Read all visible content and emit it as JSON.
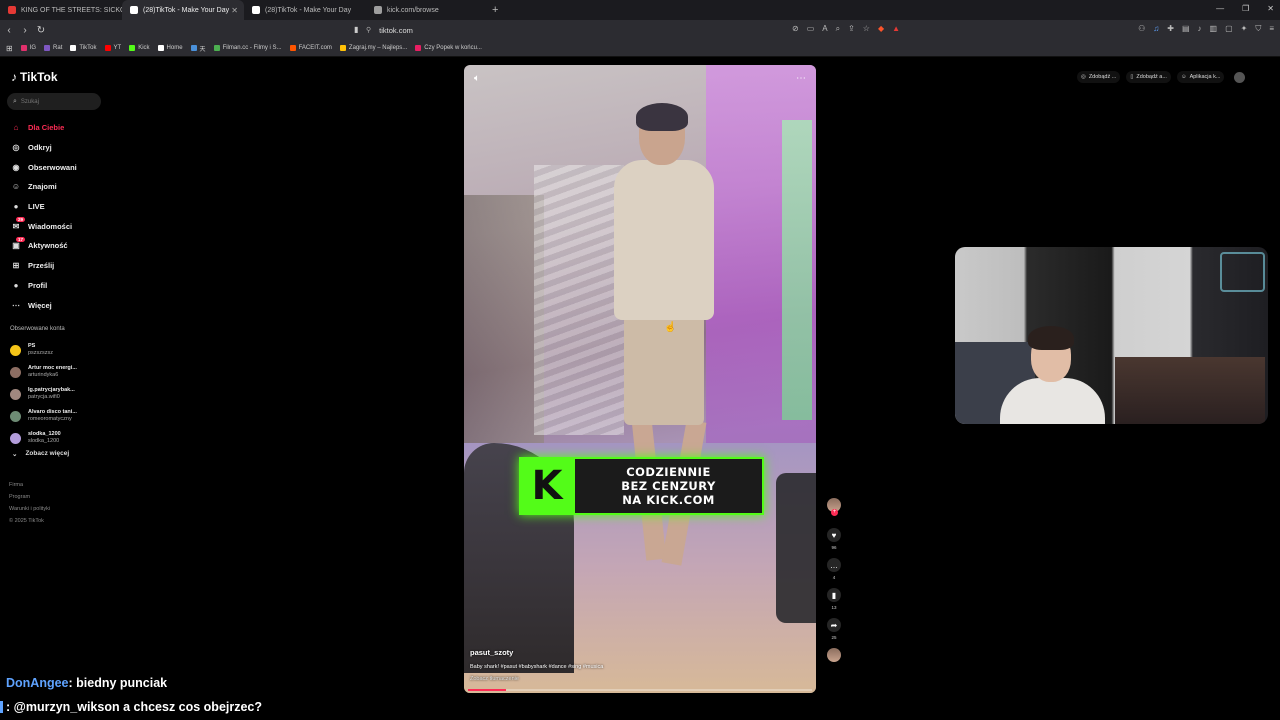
{
  "browser": {
    "tabs": [
      {
        "title": "KING OF THE STREETS: SICKO MODE",
        "color": "#e53935",
        "active": false
      },
      {
        "title": "(28)TikTok - Make Your Day",
        "color": "#ffffff",
        "active": true
      },
      {
        "title": "(28)TikTok - Make Your Day",
        "color": "#ffffff",
        "active": false
      },
      {
        "title": "kick.com/browse",
        "color": "#9e9e9e",
        "active": false
      }
    ],
    "address": "tiktok.com",
    "bookmarks": [
      {
        "label": "IG",
        "color": "#e1306c"
      },
      {
        "label": "Rat",
        "color": "#7e57c2"
      },
      {
        "label": "TikTok",
        "color": "#ffffff"
      },
      {
        "label": "YT",
        "color": "#ff0000"
      },
      {
        "label": "Kick",
        "color": "#53fc18"
      },
      {
        "label": "Home",
        "color": "#ffffff"
      },
      {
        "label": "天",
        "color": "#4a90d9"
      },
      {
        "label": "Filman.cc - Filmy i S...",
        "color": "#4caf50"
      },
      {
        "label": "FACEIT.com",
        "color": "#ff5500"
      },
      {
        "label": "Zagraj.my – Najleps...",
        "color": "#ffc107"
      },
      {
        "label": "Czy Popek w końcu...",
        "color": "#e91e63"
      }
    ]
  },
  "tiktok": {
    "logo": "TikTok",
    "search_placeholder": "Szukaj",
    "nav": [
      {
        "label": "Dla Ciebie",
        "icon": "home-icon",
        "glyph": "⌂",
        "active": true
      },
      {
        "label": "Odkryj",
        "icon": "compass-icon",
        "glyph": "◎",
        "active": false
      },
      {
        "label": "Obserwowani",
        "icon": "following-icon",
        "glyph": "◉",
        "active": false
      },
      {
        "label": "Znajomi",
        "icon": "friends-icon",
        "glyph": "☺",
        "active": false
      },
      {
        "label": "LIVE",
        "icon": "live-icon",
        "glyph": "●",
        "active": false
      },
      {
        "label": "Wiadomości",
        "icon": "messages-icon",
        "glyph": "✉",
        "active": false,
        "badge": "29"
      },
      {
        "label": "Aktywność",
        "icon": "activity-icon",
        "glyph": "▣",
        "active": false,
        "badge": "17"
      },
      {
        "label": "Prześlij",
        "icon": "upload-icon",
        "glyph": "⊞",
        "active": false
      },
      {
        "label": "Profil",
        "icon": "profile-icon",
        "glyph": "●",
        "active": false
      },
      {
        "label": "Więcej",
        "icon": "more-icon",
        "glyph": "⋯",
        "active": false
      }
    ],
    "followed_title": "Obserwowane konta",
    "followed": [
      {
        "name": "PS",
        "handle": "pszszszsz",
        "color": "#f5c518"
      },
      {
        "name": "Artur moc energi...",
        "handle": "arturindyka6",
        "color": "#8d6e63"
      },
      {
        "name": "lg.patrycjarybak...",
        "handle": "patrycja.wifi0",
        "color": "#a1887f"
      },
      {
        "name": "Alvaro disco tani...",
        "handle": "romeoromatyczny",
        "color": "#6d8b74"
      },
      {
        "name": "slodka_1200",
        "handle": "slodka_1200",
        "color": "#b39ddb"
      }
    ],
    "see_more": "Zobacz więcej",
    "footer": [
      "Firma",
      "Program",
      "Warunki i polityki",
      "© 2025 TikTok"
    ],
    "topright": [
      "Zdobądź ...",
      "Zdobądź a...",
      "Aplikacja k..."
    ]
  },
  "video": {
    "author": "pasut_szoty",
    "caption": "Baby shark! #pasut #babyshark #dance #sing #musica",
    "translate": "Zobacz tłumaczenie",
    "banner_lines": [
      "CODZIENNIE",
      "BEZ CENZURY",
      "NA KICK.COM"
    ],
    "progress": 0.11,
    "likes": "96",
    "comments": "4",
    "saves": "13",
    "shares": "25"
  },
  "chat": [
    {
      "user": "DonAngee",
      "text": ": biedny punciak"
    },
    {
      "user": "",
      "text": ": @murzyn_wikson a chcesz cos obejrzec?"
    }
  ]
}
